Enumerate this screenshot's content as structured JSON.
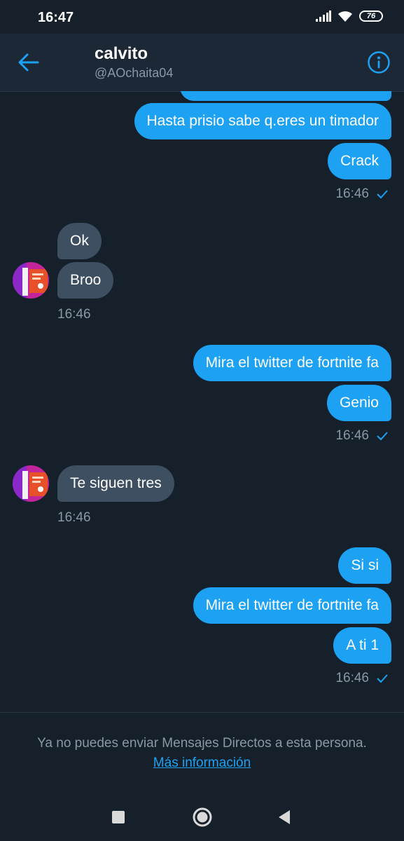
{
  "status_bar": {
    "time": "16:47",
    "battery": "76"
  },
  "header": {
    "name": "calvito",
    "handle": "@AOchaita04"
  },
  "messages": {
    "m1": "Hasta prisio sabe q.eres un timador",
    "m2": "Crack",
    "t1": "16:46",
    "m3": "Ok",
    "m4": "Broo",
    "t2": "16:46",
    "m5": "Mira el twitter de fortnite fa",
    "m6": "Genio",
    "t3": "16:46",
    "m7": "Te siguen tres",
    "t4": "16:46",
    "m8": "Si si",
    "m9": "Mira el twitter de fortnite fa",
    "m10": "A ti 1",
    "t5": "16:46"
  },
  "footer": {
    "notice": "Ya no puedes enviar Mensajes Directos a esta persona.",
    "link": "Más información"
  },
  "colors": {
    "background": "#15202b",
    "header": "#1c2836",
    "outgoing_bubble": "#1da1f2",
    "incoming_bubble": "#3d4f61",
    "muted_text": "#8899a6",
    "accent": "#1da1f2"
  },
  "icons": [
    "back-arrow-icon",
    "info-icon",
    "check-icon",
    "signal-icon",
    "wifi-icon",
    "battery-icon",
    "nav-square-icon",
    "nav-circle-icon",
    "nav-triangle-icon"
  ]
}
